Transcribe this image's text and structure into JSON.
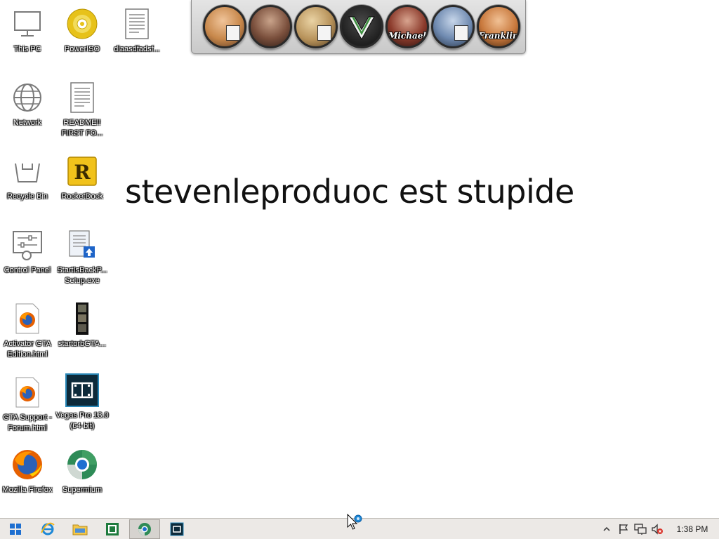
{
  "desktop": {
    "icons": [
      {
        "label": "This PC"
      },
      {
        "label": "PowerISO"
      },
      {
        "label": "diaasdfadsf..."
      },
      {
        "label": "Network"
      },
      {
        "label": "README!! FIRST FO..."
      },
      {
        "label": "Recycle Bin"
      },
      {
        "label": "RocketDock"
      },
      {
        "label": "Control Panel"
      },
      {
        "label": "StartIsBackP... Setup.exe"
      },
      {
        "label": "Activator GTA Edition.html"
      },
      {
        "label": "startorbGTA..."
      },
      {
        "label": "GTA Support - Forum.html"
      },
      {
        "label": "Vegas Pro 13.0 (64-bit)"
      },
      {
        "label": "Mozilla Firefox"
      },
      {
        "label": "Supermium"
      }
    ]
  },
  "dock": {
    "items": [
      {
        "icon": "gta-vice-city-icon",
        "text": "",
        "color": "#c7874a"
      },
      {
        "icon": "gta-iv-icon",
        "text": "",
        "color": "#7a4f3c"
      },
      {
        "icon": "gta-san-andreas-icon",
        "text": "",
        "color": "#b7925a"
      },
      {
        "icon": "gta-five-logo-icon",
        "text": "",
        "color": "#2f2f2f"
      },
      {
        "icon": "michael-icon",
        "text": "Michael",
        "color": "#8b3a2b"
      },
      {
        "icon": "gta-iii-icon",
        "text": "",
        "color": "#6f8ab0"
      },
      {
        "icon": "franklin-icon",
        "text": "Franklin",
        "color": "#c8783c"
      }
    ]
  },
  "caption": "stevenleproduoc est stupide",
  "taskbar": {
    "clock": "1:38 PM"
  },
  "colors": {
    "desktop_bg": "#ffffff",
    "taskbar_bg": "#ece9e6",
    "accent": "#1e88d6"
  }
}
